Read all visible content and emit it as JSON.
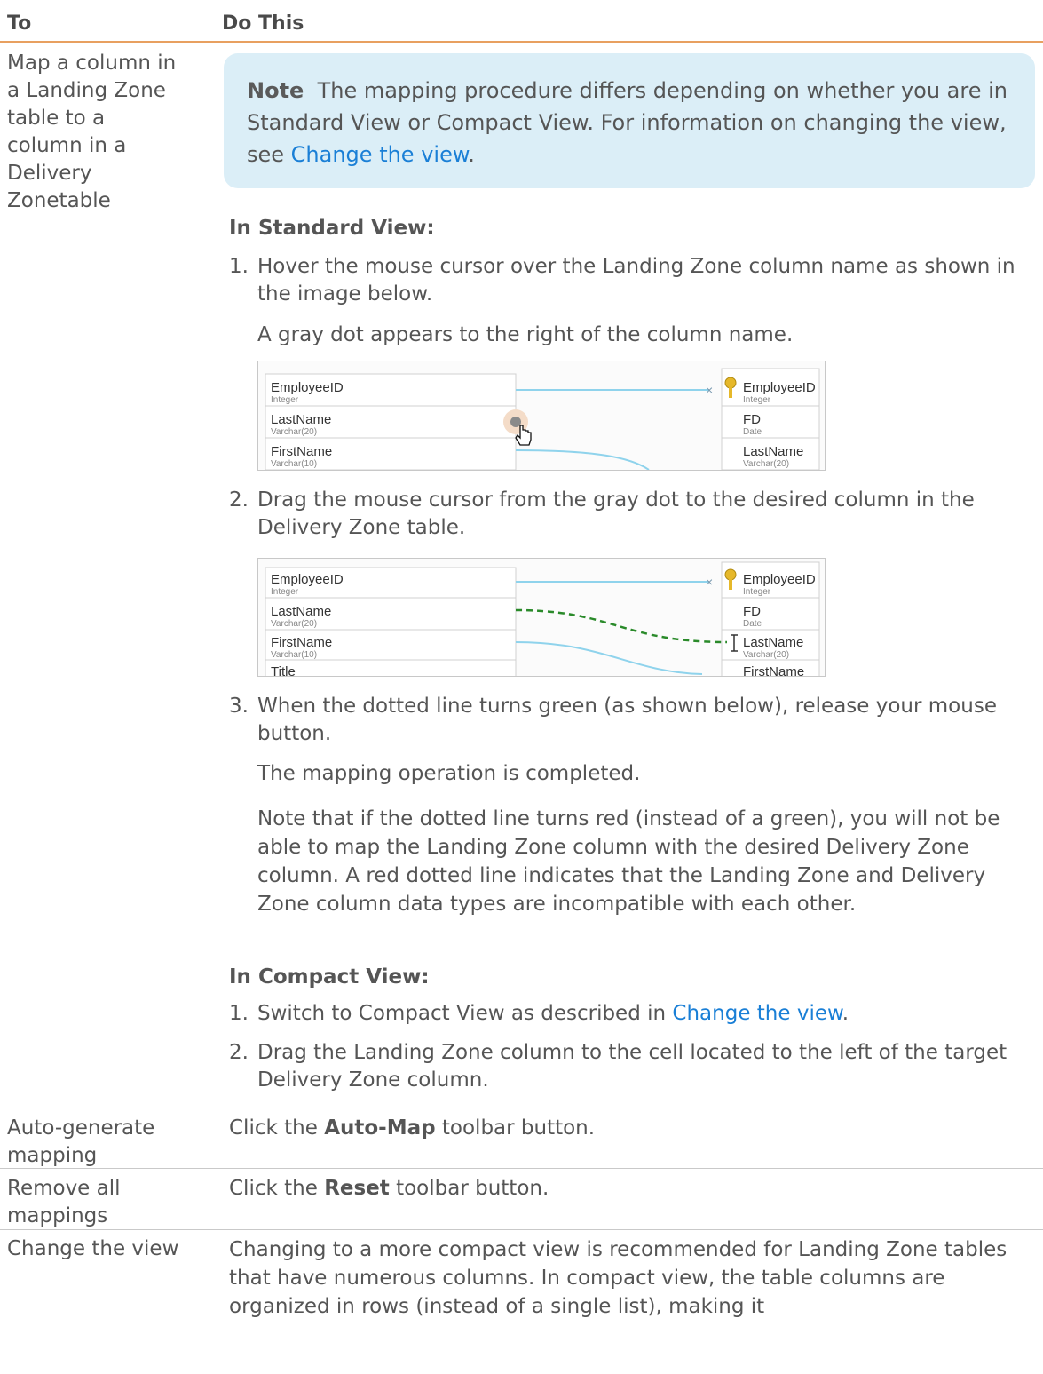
{
  "header": {
    "col_to": "To",
    "col_do": "Do This"
  },
  "row1": {
    "to": "Map a column in a Landing Zone table to a column in a Delivery Zonetable",
    "note": {
      "label": "Note",
      "text": "The mapping procedure differs depending on whether you are in Standard View or Compact View. For information on changing the view, see ",
      "link": "Change the view",
      "end": "."
    },
    "standard_heading": "In Standard View:",
    "steps_standard": [
      {
        "num": "1.",
        "text": "Hover the mouse cursor over the Landing Zone column name as shown in the image below."
      },
      {
        "num": "2.",
        "text": "Drag the mouse cursor from the gray dot to the desired column in the Delivery Zone table."
      },
      {
        "num": "3.",
        "text": "When the dotted line turns green (as shown below), release your mouse button."
      }
    ],
    "step1_result": "A gray dot appears to the right of the column name.",
    "step3_result": "The mapping operation is completed.",
    "step3_note": "Note that if the dotted line turns red (instead of a green), you will not be able to map the Landing Zone column with the desired Delivery Zone column. A red dotted line indicates that the Landing Zone and Delivery Zone column data types are incompatible with each other.",
    "compact_heading": "In Compact View:",
    "steps_compact": [
      {
        "num": "1.",
        "text": "Switch to Compact View as described in ",
        "link": "Change the view",
        "end": "."
      },
      {
        "num": "2.",
        "text": "Drag the Landing Zone column to the cell located to the left of the target Delivery Zone column."
      }
    ]
  },
  "screenshot1": {
    "left": [
      {
        "name": "EmployeeID",
        "type": "Integer"
      },
      {
        "name": "LastName",
        "type": "Varchar(20)"
      },
      {
        "name": "FirstName",
        "type": "Varchar(10)"
      }
    ],
    "right": [
      {
        "name": "EmployeeID",
        "type": "Integer"
      },
      {
        "name": "FD",
        "type": "Date"
      },
      {
        "name": "LastName",
        "type": "Varchar(20)"
      }
    ]
  },
  "screenshot2": {
    "left": [
      {
        "name": "EmployeeID",
        "type": "Integer"
      },
      {
        "name": "LastName",
        "type": "Varchar(20)"
      },
      {
        "name": "FirstName",
        "type": "Varchar(10)"
      },
      {
        "name": "Title",
        "type": ""
      }
    ],
    "right": [
      {
        "name": "EmployeeID",
        "type": "Integer"
      },
      {
        "name": "FD",
        "type": "Date"
      },
      {
        "name": "LastName",
        "type": "Varchar(20)"
      },
      {
        "name": "FirstName",
        "type": ""
      }
    ]
  },
  "row2": {
    "to": "Auto-generate mapping",
    "do_pre": "Click the ",
    "do_bold": "Auto-Map",
    "do_post": " toolbar button."
  },
  "row3": {
    "to": "Remove all mappings",
    "do_pre": "Click the ",
    "do_bold": "Reset",
    "do_post": " toolbar button."
  },
  "row4": {
    "to": "Change the view",
    "do": "Changing to a more compact view is recommended for Landing Zone tables that have numerous columns. In compact view, the table columns are organized in rows (instead of a single list), making it"
  },
  "colors": {
    "header_rule": "#e8a060",
    "note_bg": "#dbeef7",
    "link": "#1a7fd6",
    "line_blue": "#8fd3ec",
    "line_green": "#2a8a2a"
  }
}
